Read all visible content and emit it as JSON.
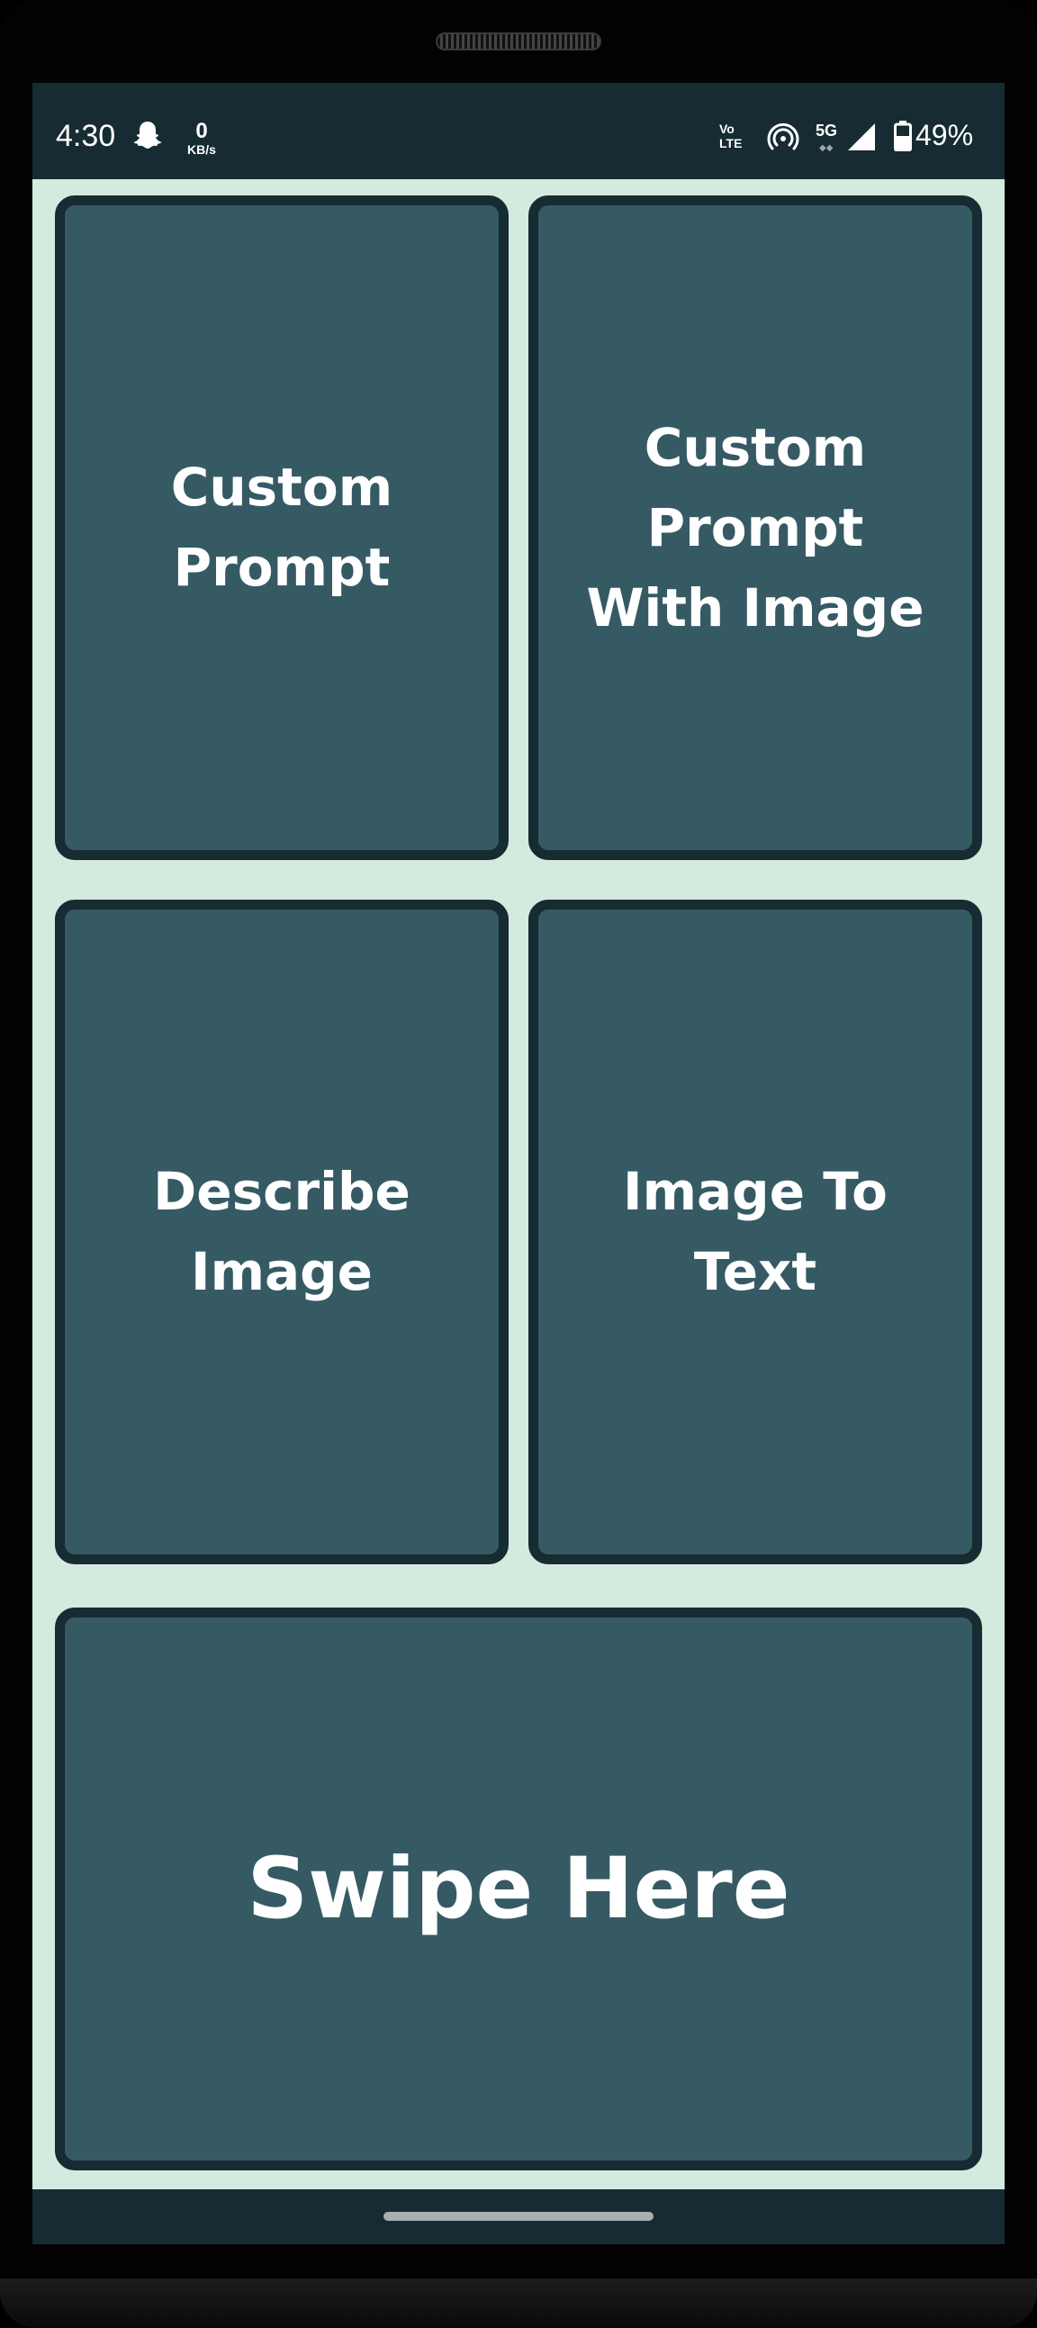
{
  "status_bar": {
    "time": "4:30",
    "net_speed_value": "0",
    "net_speed_unit": "KB/s",
    "volte_top": "Vo",
    "volte_bottom": "LTE",
    "network_type": "5G",
    "battery_percent": "49%",
    "icons": [
      "snapchat-ghost-icon",
      "hotspot-icon",
      "signal-icon",
      "battery-icon"
    ]
  },
  "tiles": {
    "custom_prompt": "Custom Prompt",
    "custom_prompt_with_image": "Custom Prompt With Image",
    "describe_image": "Describe Image",
    "image_to_text": "Image To Text",
    "swipe_here": "Swipe Here"
  },
  "colors": {
    "background": "#d3eade",
    "tile_fill": "#355a64",
    "tile_border": "#172b32",
    "bars": "#172b32",
    "text": "#ffffff"
  }
}
